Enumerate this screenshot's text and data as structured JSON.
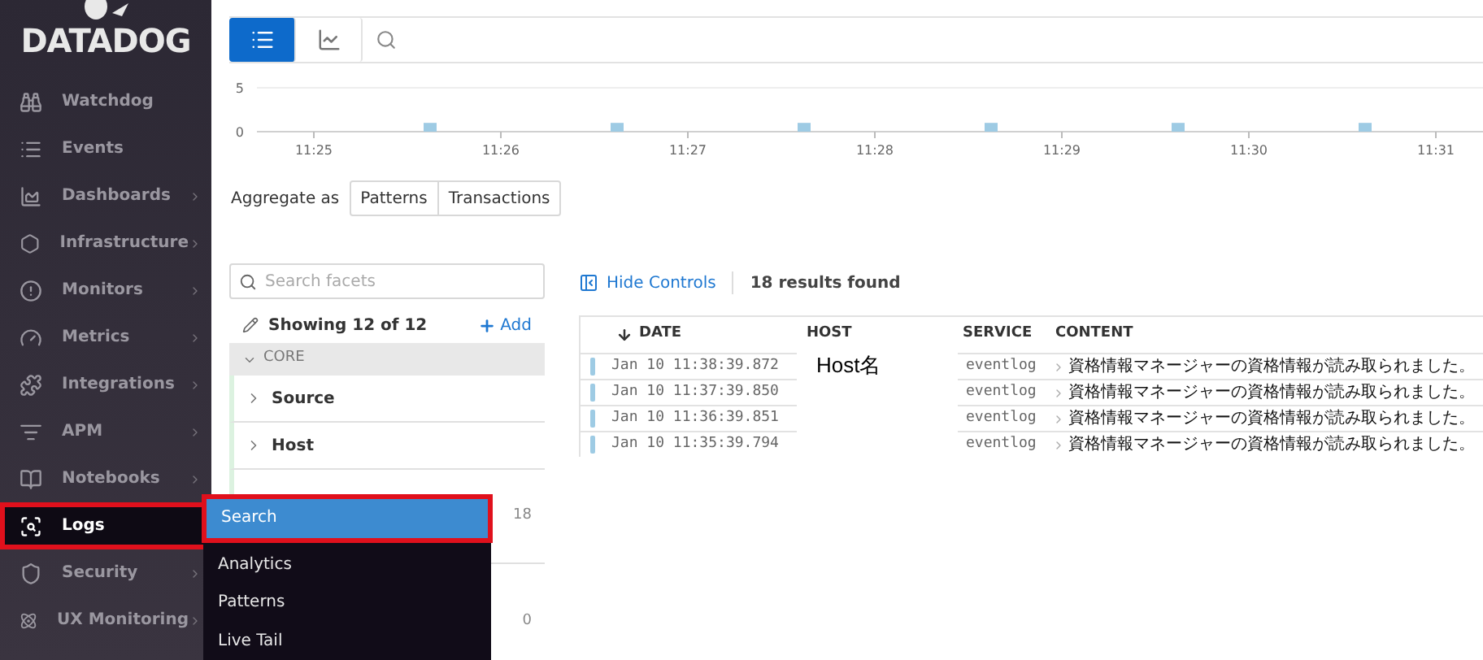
{
  "sidebar": {
    "logo": "DATADOG",
    "items": [
      {
        "label": "Watchdog",
        "has_submenu": false,
        "selected": false
      },
      {
        "label": "Events",
        "has_submenu": false,
        "selected": false
      },
      {
        "label": "Dashboards",
        "has_submenu": true,
        "selected": false
      },
      {
        "label": "Infrastructure",
        "has_submenu": true,
        "selected": false
      },
      {
        "label": "Monitors",
        "has_submenu": true,
        "selected": false
      },
      {
        "label": "Metrics",
        "has_submenu": true,
        "selected": false
      },
      {
        "label": "Integrations",
        "has_submenu": true,
        "selected": false
      },
      {
        "label": "APM",
        "has_submenu": true,
        "selected": false
      },
      {
        "label": "Notebooks",
        "has_submenu": true,
        "selected": false
      },
      {
        "label": "Logs",
        "has_submenu": false,
        "selected": true
      },
      {
        "label": "Security",
        "has_submenu": true,
        "selected": false
      },
      {
        "label": "UX Monitoring",
        "has_submenu": true,
        "selected": false
      }
    ]
  },
  "submenu": {
    "items": [
      {
        "label": "Search",
        "selected": true
      },
      {
        "label": "Analytics",
        "selected": false
      },
      {
        "label": "Patterns",
        "selected": false
      },
      {
        "label": "Live Tail",
        "selected": false
      }
    ]
  },
  "toolbar": {
    "views": [
      {
        "kind": "list",
        "selected": true
      },
      {
        "kind": "chart",
        "selected": false
      }
    ]
  },
  "histogram": {
    "chart_data": {
      "type": "bar",
      "categories": [
        "11:25",
        null,
        "11:26",
        null,
        "11:27",
        null,
        "11:28",
        null,
        "11:29",
        null,
        "11:30",
        null,
        "11:31"
      ],
      "values": [
        0,
        1,
        0,
        1,
        0,
        1,
        0,
        1,
        0,
        1,
        0,
        1,
        0
      ],
      "ylim": [
        0,
        5
      ],
      "yticks": [
        0,
        5
      ]
    }
  },
  "aggregate": {
    "label": "Aggregate as",
    "options": [
      "Patterns",
      "Transactions"
    ]
  },
  "facets": {
    "placeholder": "Search facets",
    "showing": "Showing 12 of 12",
    "add": "Add",
    "section": "CORE",
    "items": [
      "Source",
      "Host"
    ],
    "counts": [
      "18",
      "0"
    ]
  },
  "results": {
    "hide_controls": "Hide Controls",
    "count": "18 results found"
  },
  "table": {
    "columns": [
      "DATE",
      "HOST",
      "SERVICE",
      "CONTENT"
    ],
    "rows": [
      {
        "date": "Jan 10 11:38:39.872",
        "host": "Host名",
        "service": "eventlog",
        "content": "資格情報マネージャーの資格情報が読み取られました。"
      },
      {
        "date": "Jan 10 11:37:39.850",
        "service": "eventlog",
        "content": "資格情報マネージャーの資格情報が読み取られました。"
      },
      {
        "date": "Jan 10 11:36:39.851",
        "service": "eventlog",
        "content": "資格情報マネージャーの資格情報が読み取られました。"
      },
      {
        "date": "Jan 10 11:35:39.794",
        "service": "eventlog",
        "content": "資格情報マネージャーの資格情報が読み取られました。"
      }
    ]
  }
}
